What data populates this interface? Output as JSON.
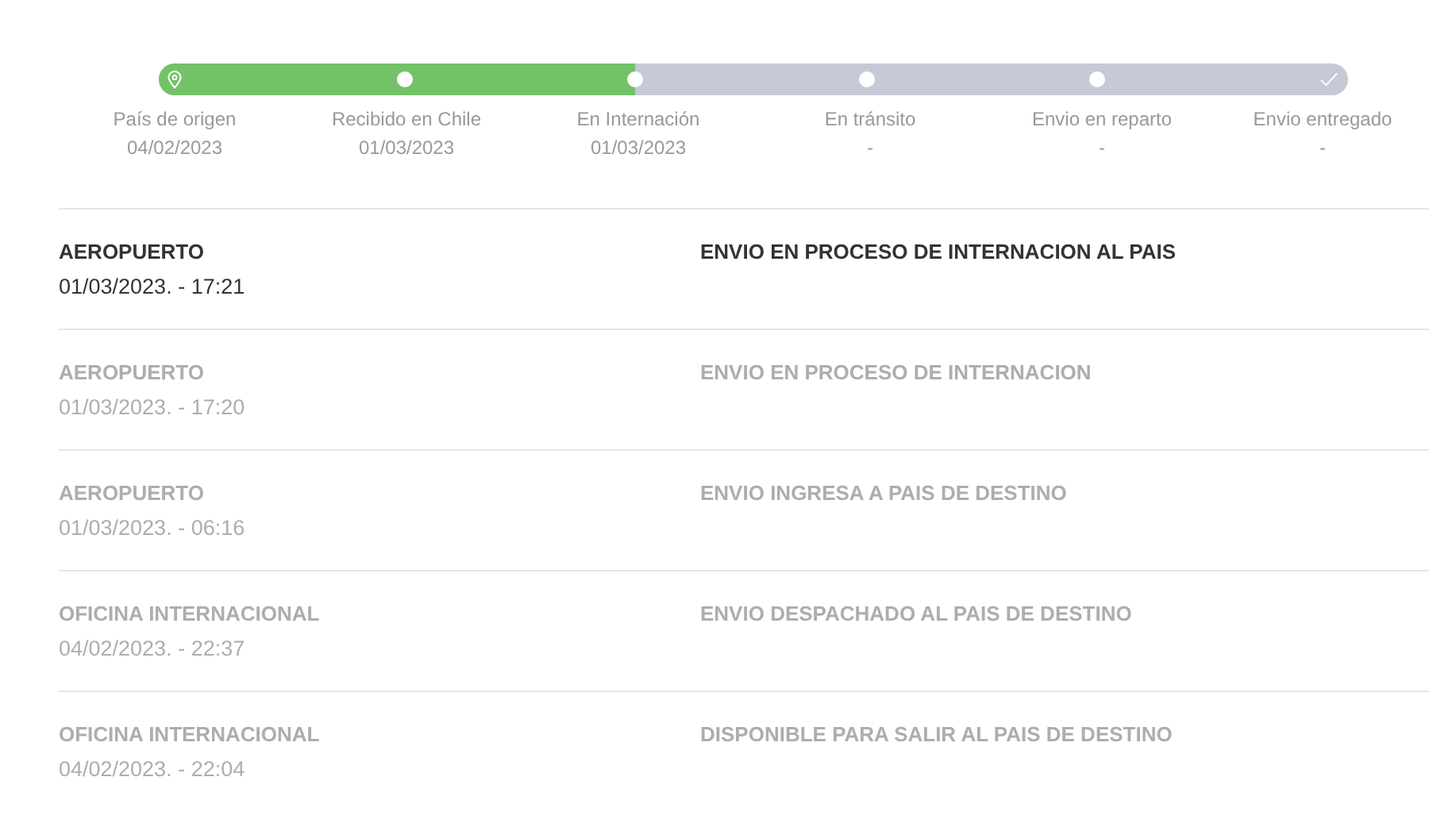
{
  "progress": {
    "level": 0.4,
    "steps": [
      {
        "kind": "origin",
        "label": "País de origen",
        "date": "04/02/2023"
      },
      {
        "kind": "dot",
        "label": "Recibido en Chile",
        "date": "01/03/2023"
      },
      {
        "kind": "dot",
        "label": "En Internación",
        "date": "01/03/2023"
      },
      {
        "kind": "dot",
        "label": "En tránsito",
        "date": "-"
      },
      {
        "kind": "dot",
        "label": "Envio en reparto",
        "date": "-"
      },
      {
        "kind": "done",
        "label": "Envio entregado",
        "date": "-"
      }
    ]
  },
  "events": [
    {
      "place": "AEROPUERTO",
      "time": "01/03/2023. - 17:21",
      "description": "ENVIO EN PROCESO DE INTERNACION AL PAIS",
      "current": true
    },
    {
      "place": "AEROPUERTO",
      "time": "01/03/2023. - 17:20",
      "description": "ENVIO EN PROCESO DE INTERNACION",
      "current": false
    },
    {
      "place": "AEROPUERTO",
      "time": "01/03/2023. - 06:16",
      "description": "ENVIO INGRESA A PAIS DE DESTINO",
      "current": false
    },
    {
      "place": "OFICINA INTERNACIONAL",
      "time": "04/02/2023. - 22:37",
      "description": "ENVIO DESPACHADO AL PAIS DE DESTINO",
      "current": false
    },
    {
      "place": "OFICINA INTERNACIONAL",
      "time": "04/02/2023. - 22:04",
      "description": "DISPONIBLE PARA SALIR AL PAIS DE DESTINO",
      "current": false
    }
  ]
}
